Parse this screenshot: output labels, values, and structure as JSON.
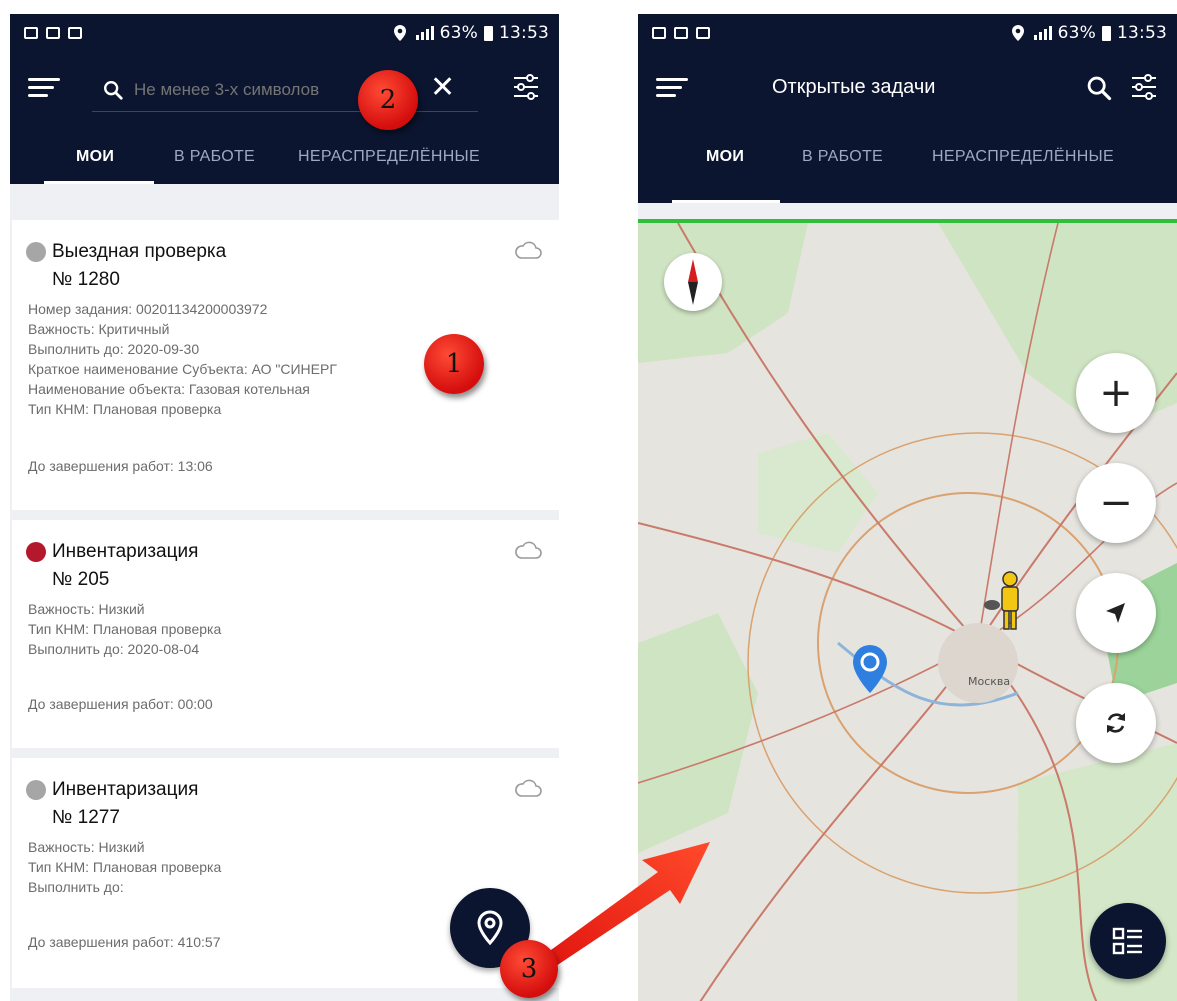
{
  "left_screen": {
    "statusbar": {
      "battery": "63%",
      "time": "13:53"
    },
    "search": {
      "placeholder": "Не менее 3-х символов",
      "clear_icon": "close-icon"
    },
    "tabs": [
      {
        "label": "МОИ",
        "active": true
      },
      {
        "label": "В РАБОТЕ",
        "active": false
      },
      {
        "label": "НЕРАСПРЕДЕЛЁННЫЕ",
        "active": false
      }
    ],
    "tasks": [
      {
        "title": "Выездная проверка",
        "number": "№ 1280",
        "status_color": "#a6a6a6",
        "lines": [
          "Номер задания: 00201134200003972",
          "Важность: Критичный",
          "Выполнить до: 2020-09-30",
          "Краткое наименование Субъекта: АО \"СИНЕРГ",
          "Наименование объекта: Газовая котельная",
          "Тип КНМ: Плановая проверка"
        ],
        "footer": "До завершения работ: 13:06"
      },
      {
        "title": "Инвентаризация",
        "number": "№ 205",
        "status_color": "#b3182d",
        "lines": [
          "Важность: Низкий",
          "Тип КНМ: Плановая проверка",
          "Выполнить до: 2020-08-04"
        ],
        "footer": "До завершения работ: 00:00"
      },
      {
        "title": "Инвентаризация",
        "number": "№ 1277",
        "status_color": "#a6a6a6",
        "lines": [
          "Важность: Низкий",
          "Тип КНМ: Плановая проверка",
          "Выполнить до:"
        ],
        "footer": "До завершения работ: 410:57"
      }
    ],
    "fab_icon": "map-pin-icon"
  },
  "right_screen": {
    "statusbar": {
      "battery": "63%",
      "time": "13:53"
    },
    "title": "Открытые задачи",
    "tabs": [
      {
        "label": "МОИ",
        "active": true
      },
      {
        "label": "В РАБОТЕ",
        "active": false
      },
      {
        "label": "НЕРАСПРЕДЕЛЁННЫЕ",
        "active": false
      }
    ],
    "map": {
      "labels": [
        "Москва"
      ],
      "controls": [
        "zoom-in-icon",
        "zoom-out-icon",
        "my-location-icon",
        "refresh-icon"
      ],
      "fab_icon": "list-icon"
    }
  },
  "annotations": [
    "1",
    "2",
    "3"
  ],
  "colors": {
    "header": "#0c1530",
    "accent_green": "#2fbf3a",
    "annotation_red": "#e0140f",
    "pin_blue": "#2f7fe0"
  }
}
